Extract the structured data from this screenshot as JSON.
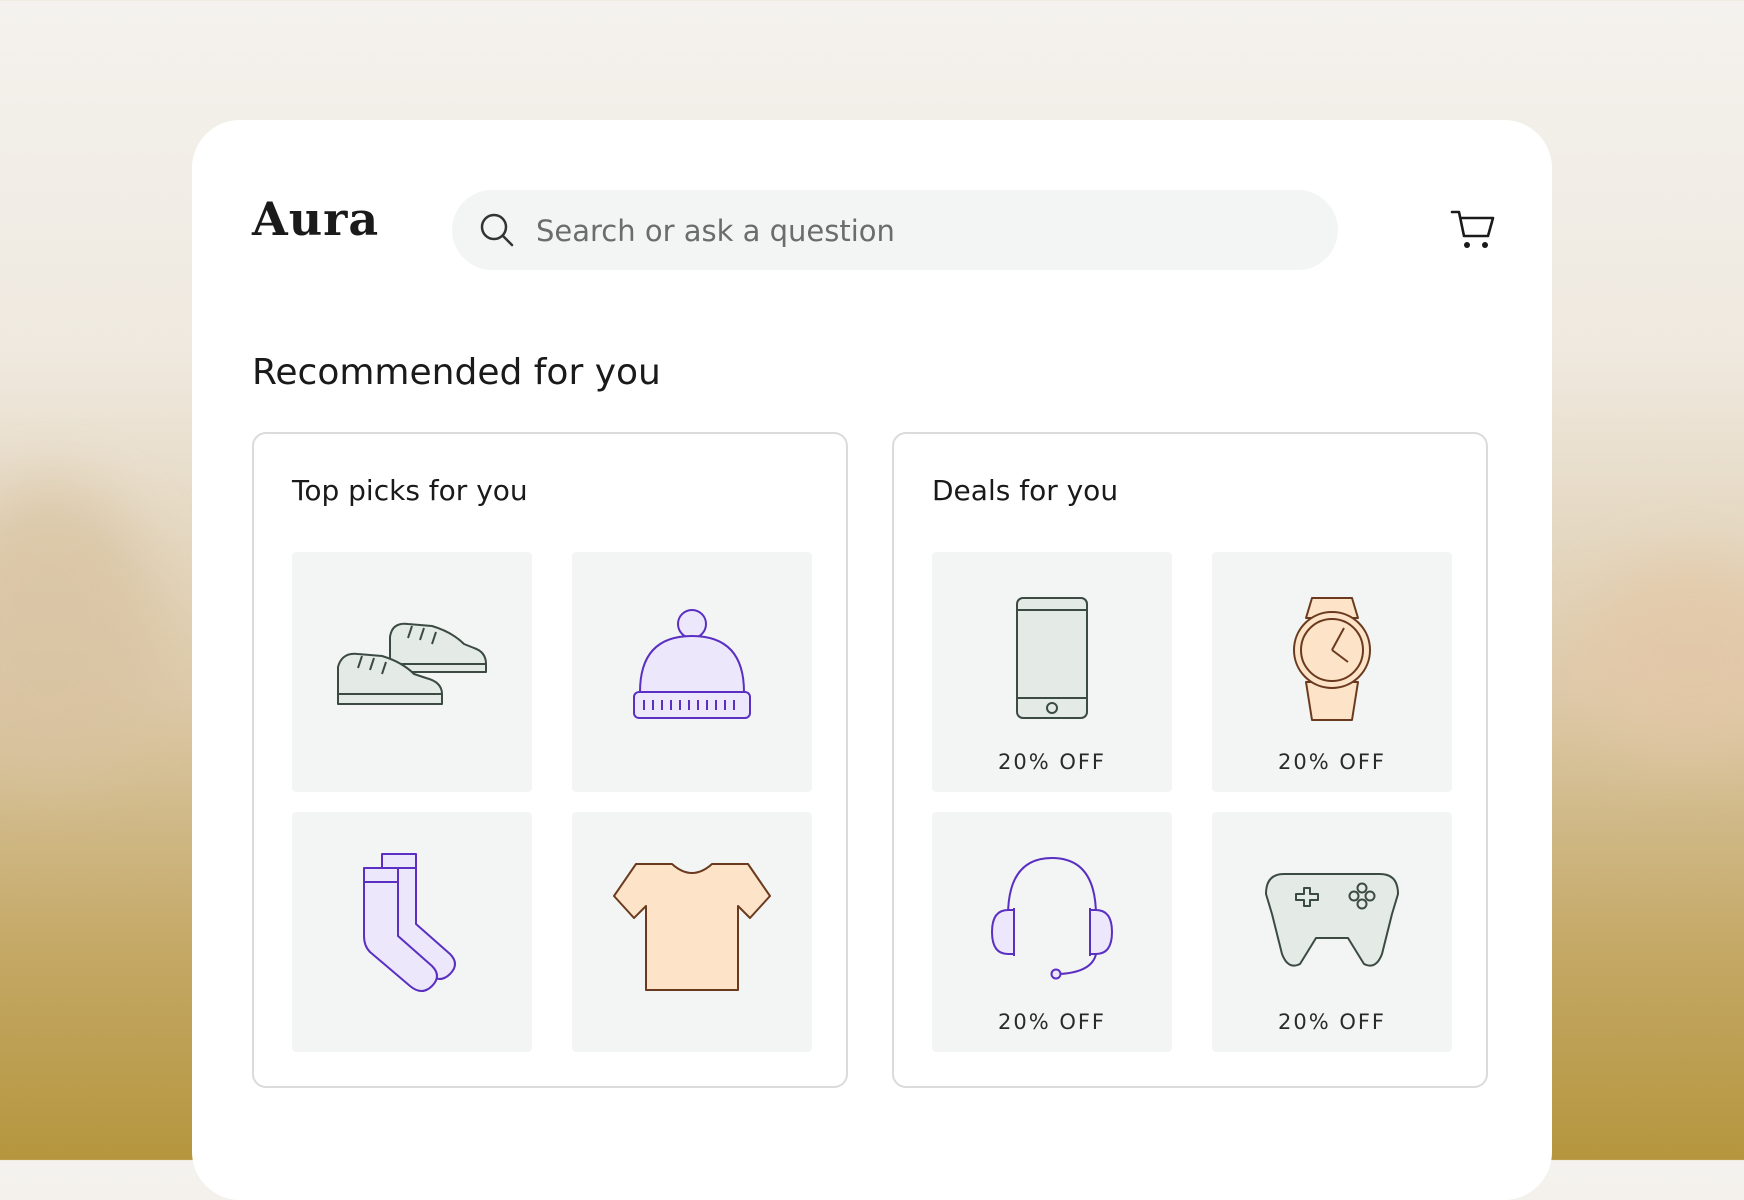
{
  "app": {
    "name": "Aura"
  },
  "search": {
    "placeholder": "Search or ask a question"
  },
  "section": {
    "title": "Recommended for you"
  },
  "top_picks": {
    "title": "Top picks for you",
    "items": [
      {
        "icon": "sneakers-icon"
      },
      {
        "icon": "beanie-icon"
      },
      {
        "icon": "socks-icon"
      },
      {
        "icon": "tshirt-icon"
      }
    ]
  },
  "deals": {
    "title": "Deals for you",
    "items": [
      {
        "icon": "smartphone-icon",
        "badge": "20% OFF"
      },
      {
        "icon": "watch-icon",
        "badge": "20% OFF"
      },
      {
        "icon": "headset-icon",
        "badge": "20% OFF"
      },
      {
        "icon": "gamepad-icon",
        "badge": "20% OFF"
      }
    ]
  },
  "colors": {
    "icon_green_fill": "#e4ebe7",
    "icon_purple_fill": "#ece7fb",
    "icon_purple_stroke": "#5a2fc2",
    "icon_peach_fill": "#fde4c8",
    "icon_brown_stroke": "#6b3a1e",
    "tile_bg": "#f2f5f4"
  }
}
